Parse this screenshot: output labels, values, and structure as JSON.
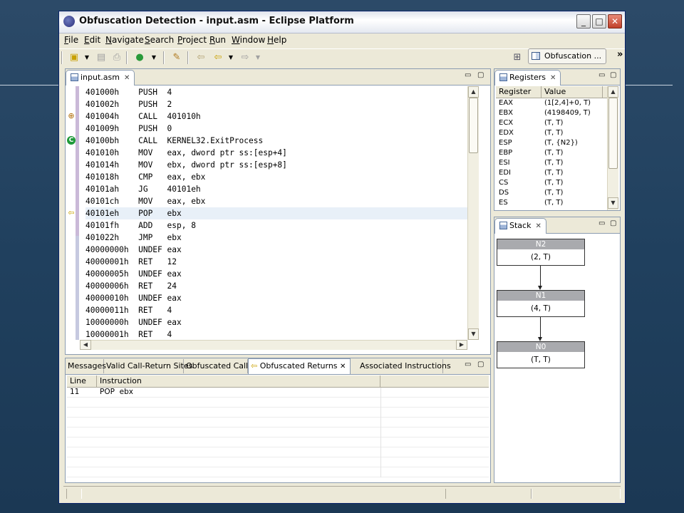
{
  "window": {
    "title": "Obfuscation Detection - input.asm - Eclipse Platform",
    "minimize_glyph": "_",
    "maximize_glyph": "□",
    "close_glyph": "✕"
  },
  "menu": [
    "File",
    "Edit",
    "Navigate",
    "Search",
    "Project",
    "Run",
    "Window",
    "Help"
  ],
  "toolbar": {
    "icons": [
      "new-wizard-icon",
      "dropdown-icon",
      "save-icon",
      "print-icon",
      "run-icon",
      "dropdown-icon",
      "pencil-icon",
      "back-icon",
      "prev-edit-icon",
      "forward-icon"
    ],
    "perspective_label": "Obfuscation ...",
    "more_glyph": "»"
  },
  "editor": {
    "tab_label": "input.asm",
    "close_glyph": "✕",
    "lines": [
      {
        "addr": "401000h",
        "op": "PUSH",
        "arg": "4"
      },
      {
        "addr": "401002h",
        "op": "PUSH",
        "arg": "2"
      },
      {
        "addr": "401004h",
        "op": "CALL",
        "arg": "401010h"
      },
      {
        "addr": "401009h",
        "op": "PUSH",
        "arg": "0"
      },
      {
        "addr": "40100bh",
        "op": "CALL",
        "arg": "KERNEL32.ExitProcess"
      },
      {
        "addr": "401010h",
        "op": "MOV",
        "arg": "eax, dword ptr ss:[esp+4]"
      },
      {
        "addr": "401014h",
        "op": "MOV",
        "arg": "ebx, dword ptr ss:[esp+8]"
      },
      {
        "addr": "401018h",
        "op": "CMP",
        "arg": "eax, ebx"
      },
      {
        "addr": "40101ah",
        "op": "JG",
        "arg": "40101eh"
      },
      {
        "addr": "40101ch",
        "op": "MOV",
        "arg": "eax, ebx"
      },
      {
        "addr": "40101eh",
        "op": "POP",
        "arg": "ebx"
      },
      {
        "addr": "40101fh",
        "op": "ADD",
        "arg": "esp, 8"
      },
      {
        "addr": "401022h",
        "op": "JMP",
        "arg": "ebx"
      },
      {
        "addr": "40000000h",
        "op": "UNDEF",
        "arg": "eax"
      },
      {
        "addr": "40000001h",
        "op": "RET",
        "arg": "12"
      },
      {
        "addr": "40000005h",
        "op": "UNDEF",
        "arg": "eax"
      },
      {
        "addr": "40000006h",
        "op": "RET",
        "arg": "24"
      },
      {
        "addr": "40000010h",
        "op": "UNDEF",
        "arg": "eax"
      },
      {
        "addr": "40000011h",
        "op": "RET",
        "arg": "4"
      },
      {
        "addr": "10000000h",
        "op": "UNDEF",
        "arg": "eax"
      },
      {
        "addr": "10000001h",
        "op": "RET",
        "arg": "4"
      }
    ],
    "highlighted_line_index": 10,
    "markers": [
      {
        "line": 2,
        "icon": "crosshair-call-icon",
        "glyph": "⊕",
        "color": "#b06a00"
      },
      {
        "line": 4,
        "icon": "call-return-icon",
        "glyph": "C",
        "color": "#1f9a3a"
      },
      {
        "line": 10,
        "icon": "obfuscated-return-arrow-icon",
        "glyph": "⇦",
        "color": "#c9a100"
      }
    ]
  },
  "registers": {
    "tab_label": "Registers",
    "columns": [
      "Register",
      "Value"
    ],
    "rows": [
      {
        "reg": "EAX",
        "val": "(1[2,4]+0, T)"
      },
      {
        "reg": "EBX",
        "val": "(4198409, T)"
      },
      {
        "reg": "ECX",
        "val": "(T, T)"
      },
      {
        "reg": "EDX",
        "val": "(T, T)"
      },
      {
        "reg": "ESP",
        "val": "(T, {N2})"
      },
      {
        "reg": "EBP",
        "val": "(T, T)"
      },
      {
        "reg": "ESI",
        "val": "(T, T)"
      },
      {
        "reg": "EDI",
        "val": "(T, T)"
      },
      {
        "reg": "CS",
        "val": "(T, T)"
      },
      {
        "reg": "DS",
        "val": "(T, T)"
      },
      {
        "reg": "ES",
        "val": "(T, T)"
      }
    ]
  },
  "stack": {
    "tab_label": "Stack",
    "nodes": [
      {
        "name": "N2",
        "value": "(2, T)"
      },
      {
        "name": "N1",
        "value": "(4, T)"
      },
      {
        "name": "N0",
        "value": "(T, T)"
      }
    ]
  },
  "bottom": {
    "tabs": [
      "Messages",
      "Valid Call-Return Sites",
      "Obfuscated Calls",
      "Obfuscated Returns",
      "Associated Instructions"
    ],
    "active_tab_index": 3,
    "columns": [
      "Line",
      "Instruction"
    ],
    "rows": [
      {
        "line": "11",
        "instruction": "POP  ebx"
      }
    ]
  },
  "colors": {
    "desktop": "#1d3a57",
    "window_chrome": "#ece9d8",
    "editor_highlight": "#e8f0f8",
    "stack_header": "#a9aaae"
  }
}
